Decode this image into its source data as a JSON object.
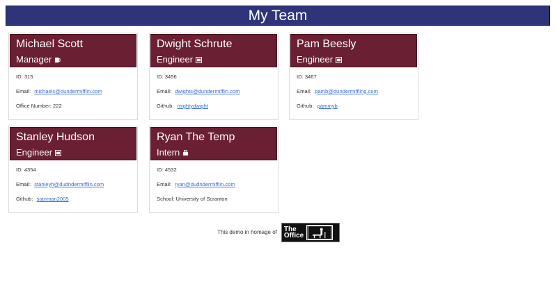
{
  "header": {
    "title": "My Team"
  },
  "cards": [
    {
      "name": "Michael Scott",
      "role": "Manager",
      "icon": "mug-icon",
      "id_label": "ID: 315",
      "email_label": "Email:",
      "email_value": "michaels@dundermifflin.com",
      "extra_label": "Office Number: 222",
      "extra_link": ""
    },
    {
      "name": "Dwight Schrute",
      "role": "Engineer",
      "icon": "glasses-icon",
      "id_label": "ID: 3456",
      "email_label": "Email:",
      "email_value": "dwights@dundermifflin.com",
      "extra_label": "Github:",
      "extra_link": "mightydwight"
    },
    {
      "name": "Pam Beesly",
      "role": "Engineer",
      "icon": "glasses-icon",
      "id_label": "ID: 3467",
      "email_label": "Email:",
      "email_value": "pamb@dundermiffling.com",
      "extra_label": "Github:",
      "extra_link": "pammyb"
    },
    {
      "name": "Stanley Hudson",
      "role": "Engineer",
      "icon": "glasses-icon",
      "id_label": "ID: 4354",
      "email_label": "Email:",
      "email_value": "stanleyh@dudndermifflin.com",
      "extra_label": "Github:",
      "extra_link": "stanman2005"
    },
    {
      "name": "Ryan The Temp",
      "role": "Intern",
      "icon": "graduation-icon",
      "id_label": "ID: 4532",
      "email_label": "Email:",
      "email_value": "ryan@dudndermifflin.com",
      "extra_label": "School: University of Scranton",
      "extra_link": ""
    }
  ],
  "footer": {
    "text": "This demo in homage of",
    "logo_text_1": "The",
    "logo_text_2": "Office"
  }
}
